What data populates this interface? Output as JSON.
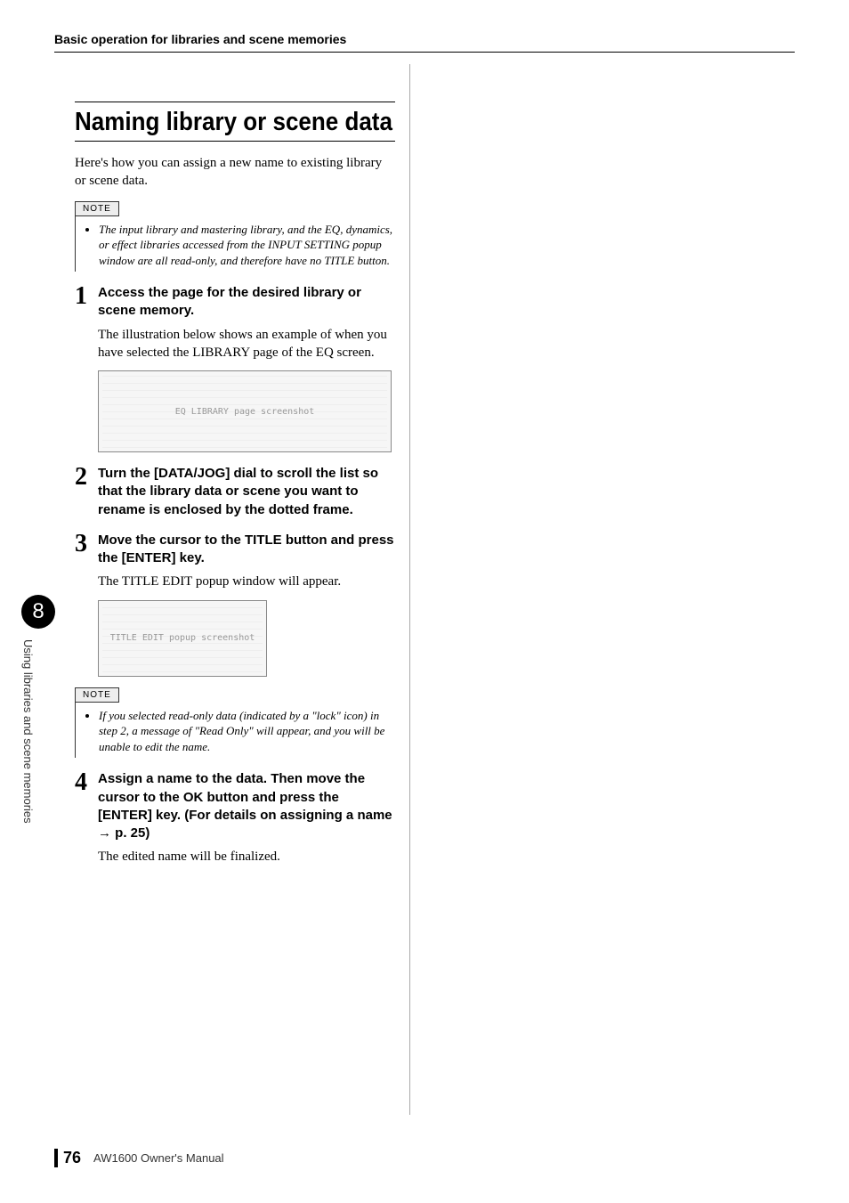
{
  "header": {
    "breadcrumb": "Basic operation for libraries and scene memories"
  },
  "section": {
    "title": "Naming library or scene data",
    "intro": "Here's how you can assign a new name to existing library or scene data."
  },
  "notes": {
    "label": "NOTE",
    "note1": "The input library and mastering library, and the EQ, dynamics, or effect libraries accessed from the INPUT SETTING popup window are all read-only, and therefore have no TITLE button.",
    "note2": "If you selected read-only data (indicated by a \"lock\" icon) in step 2, a message of \"Read Only\" will appear, and you will be unable to edit the name."
  },
  "steps": {
    "s1": {
      "num": "1",
      "title": "Access the page for the desired library or scene memory.",
      "body": "The illustration below shows an example of when you have selected the LIBRARY page of the EQ screen."
    },
    "s2": {
      "num": "2",
      "title": "Turn the [DATA/JOG] dial to scroll the list so that the library data or scene you want to rename is enclosed by the dotted frame."
    },
    "s3": {
      "num": "3",
      "title": "Move the cursor to the TITLE button and press the [ENTER] key.",
      "body": "The TITLE EDIT popup window will appear."
    },
    "s4": {
      "num": "4",
      "title": "Assign a name to the data. Then move the cursor to the OK button and press the [ENTER] key. (For details on assigning a name → p. 25)",
      "body": "The edited name will be finalized."
    }
  },
  "screenshots": {
    "eq_library": "EQ LIBRARY page screenshot",
    "title_edit": "TITLE EDIT popup screenshot"
  },
  "side": {
    "chapter": "8",
    "label": "Using libraries and scene memories"
  },
  "footer": {
    "page": "76",
    "manual": "AW1600  Owner's Manual"
  }
}
